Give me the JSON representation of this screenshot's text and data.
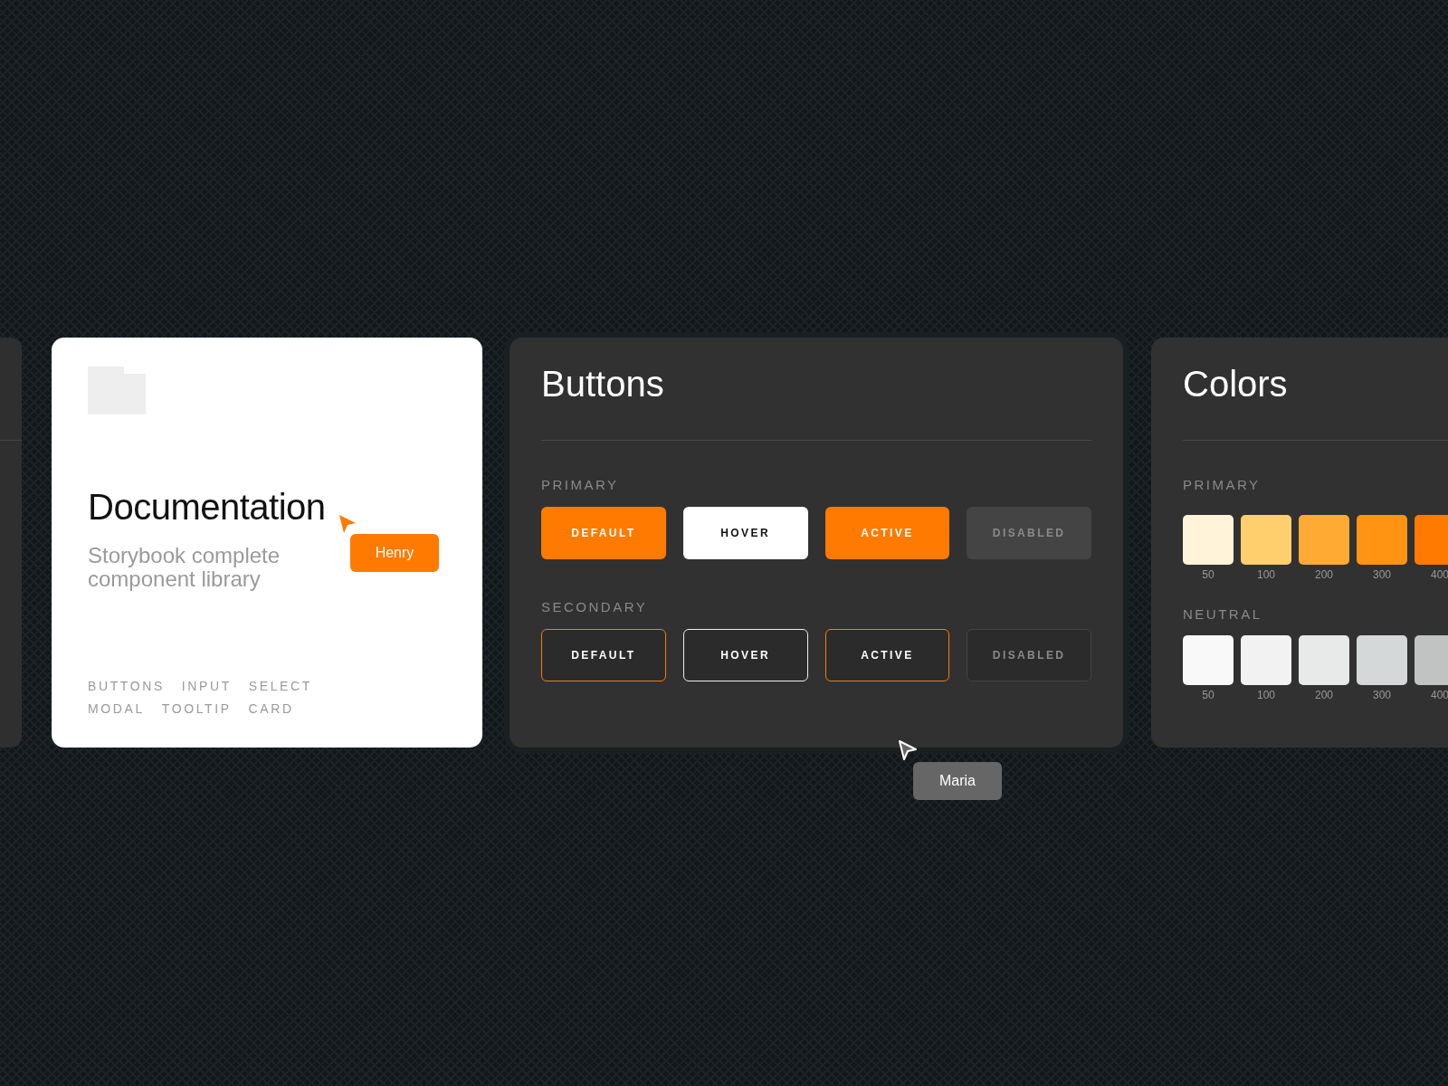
{
  "documentation": {
    "title": "Documentation",
    "subtitle": "Storybook complete component library",
    "tags": [
      "BUTTONS",
      "INPUT",
      "SELECT",
      "MODAL",
      "TOOLTIP",
      "CARD"
    ]
  },
  "buttons_panel": {
    "title": "Buttons",
    "groups": [
      {
        "label": "PRIMARY",
        "kind": "primary",
        "buttons": [
          {
            "label": "DEFAULT",
            "kind": "plain"
          },
          {
            "label": "HOVER",
            "kind": "hovered"
          },
          {
            "label": "ACTIVE",
            "kind": "pressed"
          },
          {
            "label": "DISABLED",
            "kind": "inert"
          }
        ]
      },
      {
        "label": "SECONDARY",
        "kind": "secondary",
        "buttons": [
          {
            "label": "DEFAULT",
            "kind": "plain"
          },
          {
            "label": "HOVER",
            "kind": "hovered"
          },
          {
            "label": "ACTIVE",
            "kind": "pressed"
          },
          {
            "label": "DISABLED",
            "kind": "inert"
          }
        ]
      }
    ]
  },
  "colors_panel": {
    "title": "Colors",
    "groups": [
      {
        "label": "PRIMARY",
        "swatches": [
          {
            "label": "50",
            "color": "#fff3da"
          },
          {
            "label": "100",
            "color": "#ffcf6e"
          },
          {
            "label": "200",
            "color": "#ffab33"
          },
          {
            "label": "300",
            "color": "#ff9312"
          },
          {
            "label": "400",
            "color": "#ff7a00"
          }
        ]
      },
      {
        "label": "NEUTRAL",
        "swatches": [
          {
            "label": "50",
            "color": "#f9f9f9"
          },
          {
            "label": "100",
            "color": "#f2f2f2"
          },
          {
            "label": "200",
            "color": "#e8e9e9"
          },
          {
            "label": "300",
            "color": "#d5d8d9"
          },
          {
            "label": "400",
            "color": "#c1c3c3"
          }
        ]
      }
    ]
  },
  "cursors": [
    {
      "name": "Henry",
      "color": "#ff7a00"
    },
    {
      "name": "Maria",
      "color": "#666666"
    }
  ]
}
